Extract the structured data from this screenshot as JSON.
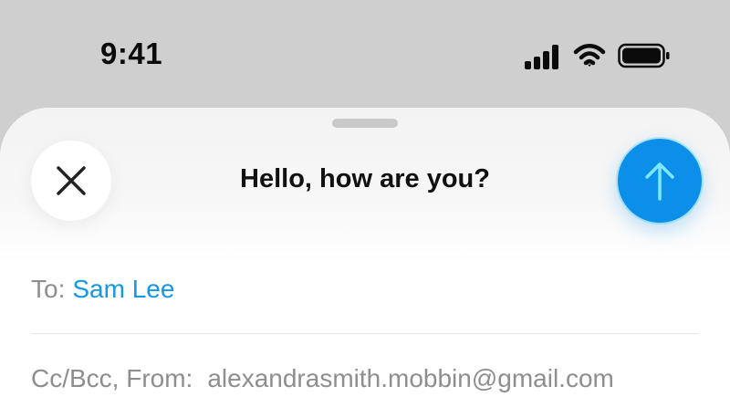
{
  "status_bar": {
    "time": "9:41",
    "signal_icon": "cellular-signal-icon",
    "wifi_icon": "wifi-icon",
    "battery_icon": "battery-icon"
  },
  "compose": {
    "title": "Hello, how are you?",
    "close_icon": "close-icon",
    "send_icon": "arrow-up-icon",
    "send_color": "#0b8fe8",
    "to_label": "To:",
    "to_value": "Sam Lee",
    "cc_label": "Cc/Bcc, From:",
    "from_value": "alexandrasmith.mobbin@gmail.com"
  }
}
